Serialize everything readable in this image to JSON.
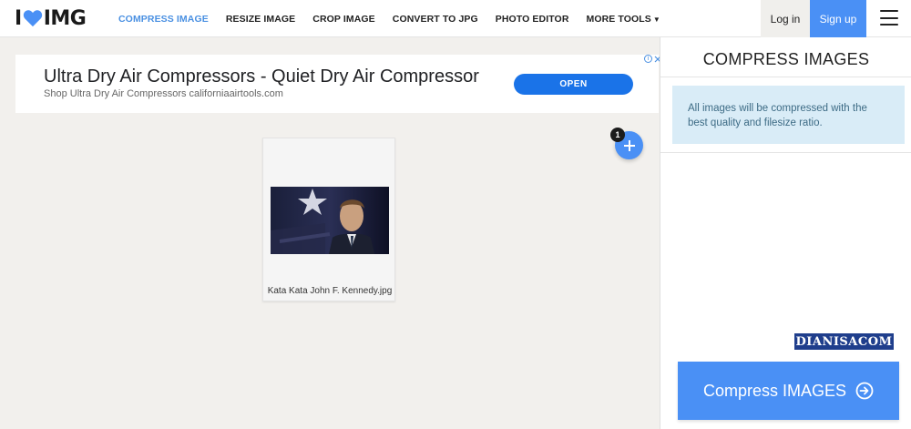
{
  "header": {
    "logo_prefix": "I",
    "logo_suffix": "IMG",
    "nav": [
      {
        "label": "COMPRESS IMAGE",
        "active": true
      },
      {
        "label": "RESIZE IMAGE"
      },
      {
        "label": "CROP IMAGE"
      },
      {
        "label": "CONVERT TO JPG"
      },
      {
        "label": "PHOTO EDITOR"
      },
      {
        "label": "MORE TOOLS"
      }
    ],
    "login_label": "Log in",
    "signup_label": "Sign up"
  },
  "ad": {
    "title": "Ultra Dry Air Compressors - Quiet Dry Air Compressor",
    "subtitle": "Shop Ultra Dry Air Compressors californiaairtools.com",
    "open_label": "OPEN"
  },
  "workspace": {
    "file_count": "1",
    "files": [
      {
        "name": "Kata Kata John F. Kennedy.jpg"
      }
    ]
  },
  "sidebar": {
    "title": "COMPRESS IMAGES",
    "info": "All images will be compressed with the best quality and filesize ratio.",
    "watermark": "DIANISACOM",
    "compress_label": "Compress IMAGES"
  },
  "colors": {
    "accent": "#4a90f5",
    "info_bg": "#d9ecf7",
    "page_bg": "#f2f0ed"
  }
}
